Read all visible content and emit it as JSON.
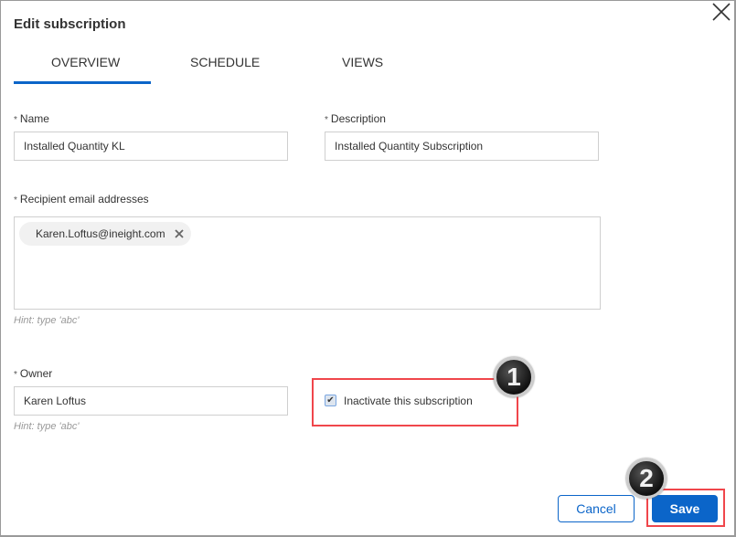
{
  "dialog": {
    "title": "Edit subscription",
    "close_icon": "close-icon"
  },
  "tabs": [
    {
      "label": "OVERVIEW",
      "active": true
    },
    {
      "label": "SCHEDULE",
      "active": false
    },
    {
      "label": "VIEWS",
      "active": false
    }
  ],
  "form": {
    "required_marker": "*",
    "name": {
      "label": "Name",
      "value": "Installed Quantity KL"
    },
    "description": {
      "label": "Description",
      "value": "Installed Quantity Subscription"
    },
    "recipients": {
      "label": "Recipient email addresses",
      "chips": [
        "Karen.Loftus@ineight.com"
      ],
      "hint": "Hint: type 'abc'"
    },
    "owner": {
      "label": "Owner",
      "value": "Karen Loftus",
      "hint": "Hint: type 'abc'"
    },
    "inactivate": {
      "label": "Inactivate this subscription",
      "checked": true
    }
  },
  "callouts": [
    "1",
    "2"
  ],
  "buttons": {
    "cancel": "Cancel",
    "save": "Save"
  },
  "colors": {
    "accent": "#0b65c9",
    "callout_box": "#f0464b"
  }
}
